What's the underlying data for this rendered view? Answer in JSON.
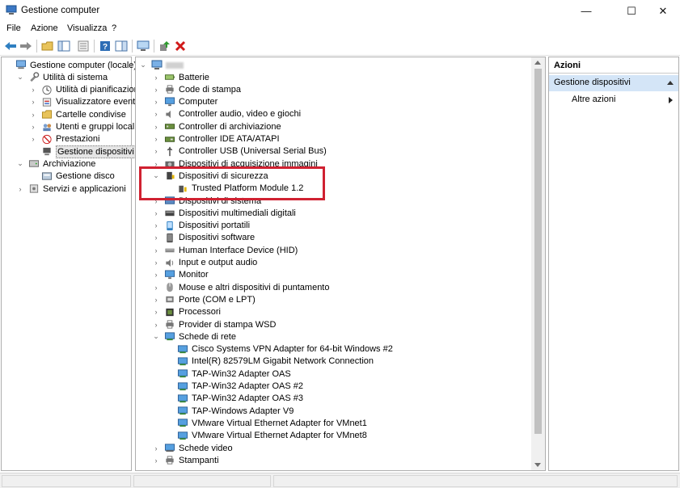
{
  "window": {
    "title": "Gestione computer",
    "minimize": "—",
    "maximize": "☐",
    "close": "✕"
  },
  "menu": [
    "File",
    "Azione",
    "Visualizza",
    "?"
  ],
  "left_tree": [
    {
      "label": "Gestione computer (locale)",
      "icon": "computer-management-icon",
      "level": 0,
      "toggle": ""
    },
    {
      "label": "Utilità di sistema",
      "icon": "tools-icon",
      "level": 1,
      "toggle": "v"
    },
    {
      "label": "Utilità di pianificazione",
      "icon": "clock-icon",
      "level": 2,
      "toggle": ">"
    },
    {
      "label": "Visualizzatore eventi",
      "icon": "event-viewer-icon",
      "level": 2,
      "toggle": ">"
    },
    {
      "label": "Cartelle condivise",
      "icon": "shared-folder-icon",
      "level": 2,
      "toggle": ">"
    },
    {
      "label": "Utenti e gruppi locali",
      "icon": "users-icon",
      "level": 2,
      "toggle": ">"
    },
    {
      "label": "Prestazioni",
      "icon": "performance-icon",
      "level": 2,
      "toggle": ">"
    },
    {
      "label": "Gestione dispositivi",
      "icon": "device-manager-icon",
      "level": 2,
      "toggle": "",
      "selected": true
    },
    {
      "label": "Archiviazione",
      "icon": "storage-icon",
      "level": 1,
      "toggle": "v"
    },
    {
      "label": "Gestione disco",
      "icon": "disk-icon",
      "level": 2,
      "toggle": ""
    },
    {
      "label": "Servizi e applicazioni",
      "icon": "services-icon",
      "level": 1,
      "toggle": ">"
    }
  ],
  "device_tree": [
    {
      "label": "Batterie",
      "icon": "battery-icon",
      "level": 1,
      "toggle": ">"
    },
    {
      "label": "Code di stampa",
      "icon": "printer-icon",
      "level": 1,
      "toggle": ">"
    },
    {
      "label": "Computer",
      "icon": "monitor-icon",
      "level": 1,
      "toggle": ">"
    },
    {
      "label": "Controller audio, video e giochi",
      "icon": "speaker-icon",
      "level": 1,
      "toggle": ">"
    },
    {
      "label": "Controller di archiviazione",
      "icon": "storage-controller-icon",
      "level": 1,
      "toggle": ">"
    },
    {
      "label": "Controller IDE ATA/ATAPI",
      "icon": "ide-icon",
      "level": 1,
      "toggle": ">"
    },
    {
      "label": "Controller USB (Universal Serial Bus)",
      "icon": "usb-icon",
      "level": 1,
      "toggle": ">"
    },
    {
      "label": "Dispositivi di acquisizione immagini",
      "icon": "camera-icon",
      "level": 1,
      "toggle": ">"
    },
    {
      "label": "Dispositivi di sicurezza",
      "icon": "security-device-icon",
      "level": 1,
      "toggle": "v"
    },
    {
      "label": "Trusted Platform Module 1.2",
      "icon": "tpm-icon",
      "level": 2,
      "toggle": ""
    },
    {
      "label": "Dispositivi di sistema",
      "icon": "system-device-icon",
      "level": 1,
      "toggle": ">"
    },
    {
      "label": "Dispositivi multimediali digitali",
      "icon": "media-icon",
      "level": 1,
      "toggle": ">"
    },
    {
      "label": "Dispositivi portatili",
      "icon": "portable-icon",
      "level": 1,
      "toggle": ">"
    },
    {
      "label": "Dispositivi software",
      "icon": "software-device-icon",
      "level": 1,
      "toggle": ">"
    },
    {
      "label": "Human Interface Device (HID)",
      "icon": "hid-icon",
      "level": 1,
      "toggle": ">"
    },
    {
      "label": "Input e output audio",
      "icon": "audio-io-icon",
      "level": 1,
      "toggle": ">"
    },
    {
      "label": "Monitor",
      "icon": "monitor-icon",
      "level": 1,
      "toggle": ">"
    },
    {
      "label": "Mouse e altri dispositivi di puntamento",
      "icon": "mouse-icon",
      "level": 1,
      "toggle": ">"
    },
    {
      "label": "Porte (COM e LPT)",
      "icon": "port-icon",
      "level": 1,
      "toggle": ">"
    },
    {
      "label": "Processori",
      "icon": "processor-icon",
      "level": 1,
      "toggle": ">"
    },
    {
      "label": "Provider di stampa WSD",
      "icon": "printer-icon",
      "level": 1,
      "toggle": ">"
    },
    {
      "label": "Schede di rete",
      "icon": "network-adapter-icon",
      "level": 1,
      "toggle": "v"
    },
    {
      "label": "Cisco Systems VPN Adapter for 64-bit Windows #2",
      "icon": "network-adapter-icon",
      "level": 2,
      "toggle": ""
    },
    {
      "label": "Intel(R) 82579LM Gigabit Network Connection",
      "icon": "network-adapter-icon",
      "level": 2,
      "toggle": ""
    },
    {
      "label": "TAP-Win32 Adapter OAS",
      "icon": "network-adapter-icon",
      "level": 2,
      "toggle": ""
    },
    {
      "label": "TAP-Win32 Adapter OAS #2",
      "icon": "network-adapter-icon",
      "level": 2,
      "toggle": ""
    },
    {
      "label": "TAP-Win32 Adapter OAS #3",
      "icon": "network-adapter-icon",
      "level": 2,
      "toggle": ""
    },
    {
      "label": "TAP-Windows Adapter V9",
      "icon": "network-adapter-icon",
      "level": 2,
      "toggle": ""
    },
    {
      "label": "VMware Virtual Ethernet Adapter for VMnet1",
      "icon": "network-adapter-icon",
      "level": 2,
      "toggle": ""
    },
    {
      "label": "VMware Virtual Ethernet Adapter for VMnet8",
      "icon": "network-adapter-icon",
      "level": 2,
      "toggle": ""
    },
    {
      "label": "Schede video",
      "icon": "display-adapter-icon",
      "level": 1,
      "toggle": ">"
    },
    {
      "label": "Stampanti",
      "icon": "printer-icon",
      "level": 1,
      "toggle": ">"
    }
  ],
  "actions": {
    "header": "Azioni",
    "section": "Gestione dispositivi",
    "more": "Altre azioni"
  },
  "colors": {
    "highlight_box": "#d02131",
    "selection_bg": "#d4e5f7"
  }
}
